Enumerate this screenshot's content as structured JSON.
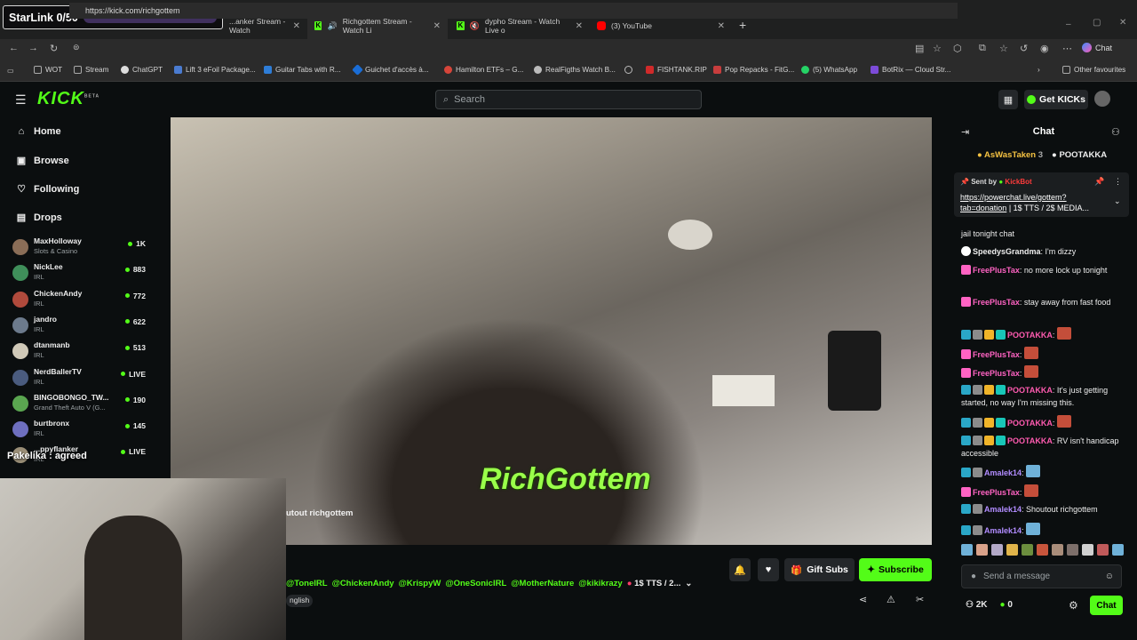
{
  "overlay": {
    "starlink": "StarLink 0/50",
    "webcam_caption": "Pakelika : agreed",
    "stream_caption": "utout richgottem",
    "watermark": "RichGottem"
  },
  "browser": {
    "tabs": [
      {
        "label": "...anker Stream - Watch",
        "icon": "kick-favicon"
      },
      {
        "label": "Richgottem Stream - Watch Li",
        "icon": "kick-favicon"
      },
      {
        "label": "dypho Stream - Watch Live o",
        "icon": "kick-favicon"
      },
      {
        "label": "(3) YouTube",
        "icon": "youtube-favicon"
      }
    ],
    "url": "https://kick.com/richgottem",
    "copilot_label": "Chat",
    "bookmarks": [
      "WOT",
      "Stream",
      "ChatGPT",
      "Lift 3 eFoil Package...",
      "Guitar Tabs with R...",
      "Guichet d'accès à...",
      "Hamilton ETFs – G...",
      "RealFigths Watch B...",
      "FISHTANK.RIP",
      "Pop Repacks - FitG...",
      "(5) WhatsApp",
      "BotRix — Cloud Str..."
    ],
    "other_favourites": "Other favourites"
  },
  "kick": {
    "logo": "KICK",
    "logo_badge": "BETA",
    "search_placeholder": "Search",
    "get_kicks": "Get KICKs",
    "nav": [
      "Home",
      "Browse",
      "Following",
      "Drops"
    ],
    "channels": [
      {
        "name": "MaxHolloway",
        "category": "Slots & Casino",
        "viewers": "1K",
        "avatar_color": "#8a6d57"
      },
      {
        "name": "NickLee",
        "category": "IRL",
        "viewers": "883",
        "avatar_color": "#3f8f5a"
      },
      {
        "name": "ChickenAndy",
        "category": "IRL",
        "viewers": "772",
        "avatar_color": "#b04a3c"
      },
      {
        "name": "jandro",
        "category": "IRL",
        "viewers": "622",
        "avatar_color": "#6c7a8c"
      },
      {
        "name": "dtanmanb",
        "category": "IRL",
        "viewers": "513",
        "avatar_color": "#d0c9b8"
      },
      {
        "name": "NerdBallerTV",
        "category": "IRL",
        "viewers": "LIVE",
        "avatar_color": "#4a5b7e"
      },
      {
        "name": "BINGOBONGO_TW...",
        "category": "Grand Theft Auto V (G...",
        "viewers": "190",
        "avatar_color": "#5aa650"
      },
      {
        "name": "burtbronx",
        "category": "IRL",
        "viewers": "145",
        "avatar_color": "#6e6fbf"
      },
      {
        "name": "...ppyflanker",
        "category": "IRL",
        "viewers": "LIVE",
        "avatar_color": "#9a8e77"
      }
    ],
    "tags": [
      "@ToneIRL",
      "@ChickenAndy",
      "@KrispyW",
      "@OneSonicIRL",
      "@MotherNature",
      "@kikikrazy"
    ],
    "tts": "1$ TTS / 2...",
    "language": "nglish",
    "gift_subs": "Gift Subs",
    "subscribe": "Subscribe"
  },
  "chat": {
    "title": "Chat",
    "top_gifters": [
      {
        "name": "AsWasTaken",
        "count": "3"
      },
      {
        "name": "POOTAKKA",
        "count": ""
      }
    ],
    "pinned": {
      "sent_by": "Sent by",
      "bot": "KickBot",
      "link": "https://powerchat.live/gottem?tab=donation",
      "rest": "| 1$ TTS / 2$ MEDIA..."
    },
    "messages": [
      {
        "user": "",
        "color": "#eeeeee",
        "text": "jail tonight chat"
      },
      {
        "user": "SpeedysGrandma",
        "color": "#eeeeee",
        "text": "I'm dizzy"
      },
      {
        "user": "FreePlusTax",
        "color": "#ff63c3",
        "text": "no more lock up tonight"
      },
      {
        "user": "FreePlusTax",
        "color": "#ff63c3",
        "text": "stay away from fast food"
      },
      {
        "user": "POOTAKKA",
        "color": "#ff5bb0",
        "text": ""
      },
      {
        "user": "FreePlusTax",
        "color": "#ff63c3",
        "text": ""
      },
      {
        "user": "FreePlusTax",
        "color": "#ff63c3",
        "text": ""
      },
      {
        "user": "POOTAKKA",
        "color": "#ff5bb0",
        "text": "It's just getting started, no way I'm missing this."
      },
      {
        "user": "POOTAKKA",
        "color": "#ff5bb0",
        "text": ""
      },
      {
        "user": "POOTAKKA",
        "color": "#ff5bb0",
        "text": "RV isn't handicap accessible"
      },
      {
        "user": "Amalek14",
        "color": "#b18cff",
        "text": ""
      },
      {
        "user": "FreePlusTax",
        "color": "#ff63c3",
        "text": ""
      },
      {
        "user": "Amalek14",
        "color": "#b18cff",
        "text": "Shoutout richgottem"
      },
      {
        "user": "Amalek14",
        "color": "#b18cff",
        "text": ""
      }
    ],
    "send_placeholder": "Send a message",
    "followers": "2K",
    "kicks": "0",
    "send_button": "Chat"
  }
}
